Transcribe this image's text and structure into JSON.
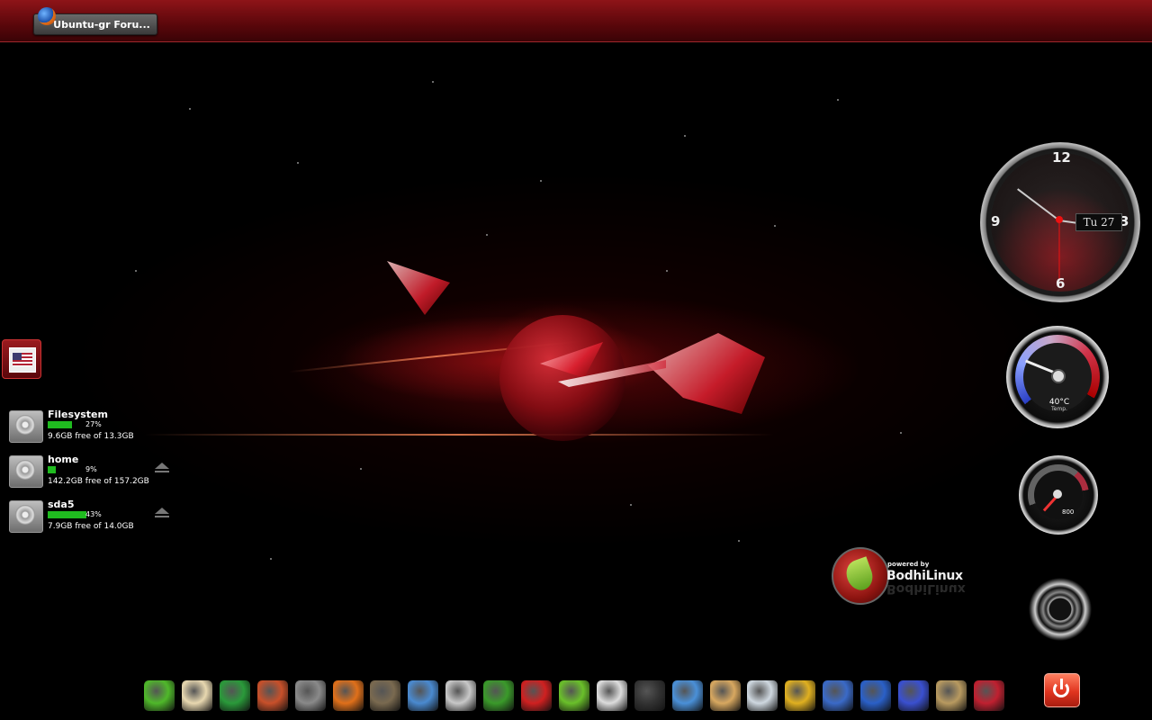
{
  "taskbar": {
    "window_title": "Ubuntu-gr Foru..."
  },
  "keyboard_layout": {
    "flag": "us-flag-icon"
  },
  "filesystems": [
    {
      "name": "Filesystem",
      "percent": "27%",
      "free_text": "9.6GB free of 13.3GB",
      "fill": 0.27,
      "ejectable": false
    },
    {
      "name": "home",
      "percent": "9%",
      "free_text": "142.2GB free of 157.2GB",
      "fill": 0.09,
      "ejectable": true
    },
    {
      "name": "sda5",
      "percent": "43%",
      "free_text": "7.9GB free of 14.0GB",
      "fill": 0.43,
      "ejectable": true
    }
  ],
  "clock": {
    "numbers": [
      "12",
      "3",
      "6",
      "9"
    ],
    "date": "Tu 27"
  },
  "temperature": {
    "value": "40°C",
    "label": "Temp."
  },
  "speed": {
    "value": "800"
  },
  "branding": {
    "small": "powered by",
    "name": "BodhiLinux"
  },
  "dock": {
    "icons": [
      {
        "name": "leaf-launcher-icon",
        "color": "#4fb82a"
      },
      {
        "name": "egg-icon",
        "color": "#e8d8b0"
      },
      {
        "name": "monitor-icon",
        "color": "#2a9a3a"
      },
      {
        "name": "red-panda-icon",
        "color": "#c8502a"
      },
      {
        "name": "image-viewer-icon",
        "color": "#8a8a8a"
      },
      {
        "name": "firefox-icon",
        "color": "#e0701a"
      },
      {
        "name": "gimp-icon",
        "color": "#7a6a50"
      },
      {
        "name": "inkscape-icon",
        "color": "#4a8ad0"
      },
      {
        "name": "photo-editor-icon",
        "color": "#c8c8c8"
      },
      {
        "name": "globe-tool-icon",
        "color": "#3a9a2a"
      },
      {
        "name": "german-flag-icon",
        "color": "#d02020"
      },
      {
        "name": "leaf-editor-icon",
        "color": "#6ac02a"
      },
      {
        "name": "yin-yang-icon",
        "color": "#dddddd"
      },
      {
        "name": "terminal-icon",
        "color": "#333333"
      },
      {
        "name": "swirl-icon",
        "color": "#4a90d8"
      },
      {
        "name": "music-folder-icon",
        "color": "#d8a860"
      },
      {
        "name": "cd-player-icon",
        "color": "#cfd8e0"
      },
      {
        "name": "color-palette-icon",
        "color": "#e0b020"
      },
      {
        "name": "thunderbird-icon",
        "color": "#3a6ac8"
      },
      {
        "name": "network-globe-icon",
        "color": "#2a60c8"
      },
      {
        "name": "usb-drive-icon",
        "color": "#3a50d0"
      },
      {
        "name": "gramophone-icon",
        "color": "#b89a60"
      },
      {
        "name": "red-dragon-icon",
        "color": "#c02030"
      }
    ],
    "power": "power-icon"
  }
}
